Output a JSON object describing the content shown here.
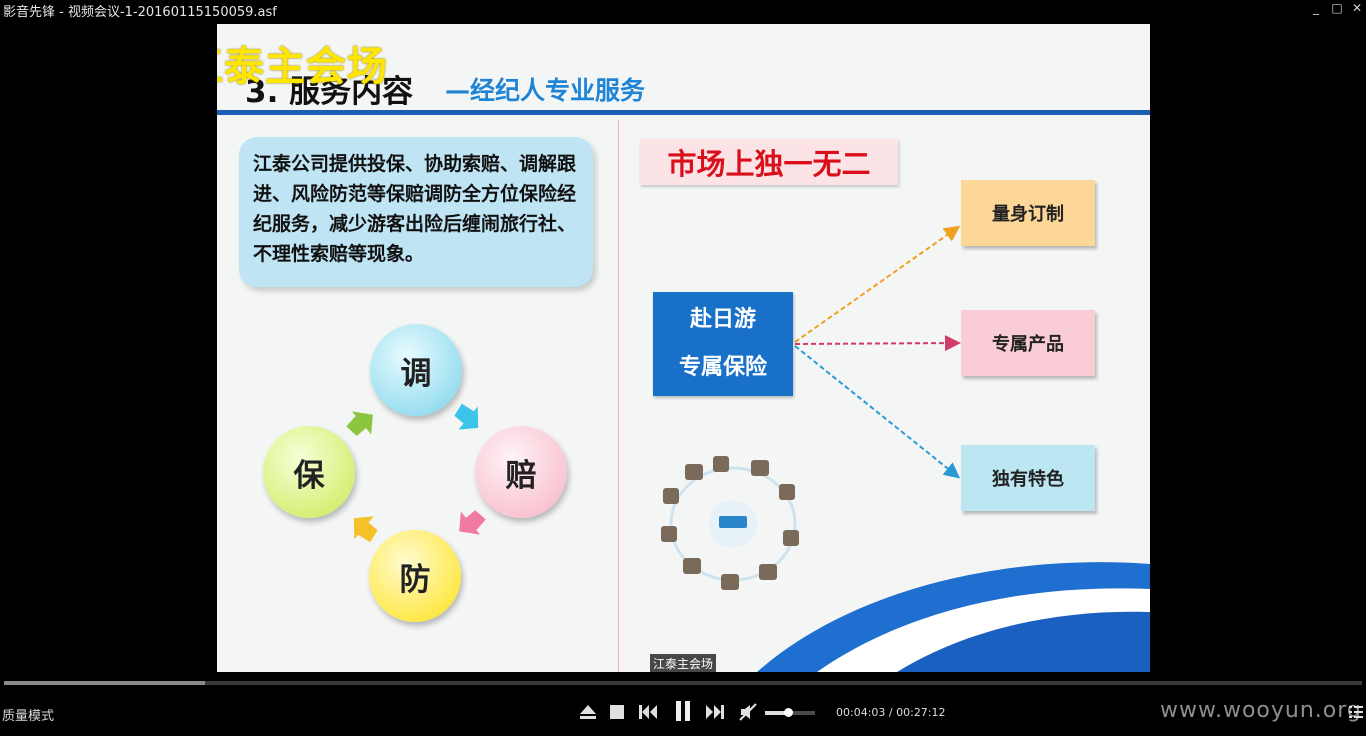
{
  "window": {
    "title": "影音先锋 - 视频会议-1-20160115150059.asf",
    "minimize_label": "_",
    "maximize_label": "□",
    "close_label": "✕"
  },
  "slide": {
    "watermark": "江泰主会场",
    "title": "3. 服务内容",
    "subtitle": "—经纪人专业服务",
    "description": "江泰公司提供投保、协助索赔、调解跟进、风险防范等保赔调防全方位保险经纪服务，减少游客出险后缠闹旅行社、不理性索赔等现象。",
    "cycle": [
      "调",
      "赔",
      "防",
      "保"
    ],
    "market_label": "市场上独一无二",
    "product": {
      "line1": "赴日游",
      "line2": "专属保险"
    },
    "features": [
      "量身订制",
      "专属产品",
      "独有特色"
    ],
    "caption": "江泰主会场",
    "colors": {
      "accent_blue": "#1870c8",
      "market_red": "#d9101c",
      "watermark_yellow": "#ffe600"
    }
  },
  "player": {
    "mode_label": "质量模式",
    "progress": 0.148,
    "current_time": "00:04:03",
    "total_time": "00:27:12",
    "time_separator": " / ",
    "volume": 0.45,
    "site_watermark": "www.wooyun.org",
    "icons": [
      "eject-icon",
      "stop-icon",
      "previous-icon",
      "pause-icon",
      "next-icon",
      "mute-icon",
      "playlist-icon"
    ]
  }
}
